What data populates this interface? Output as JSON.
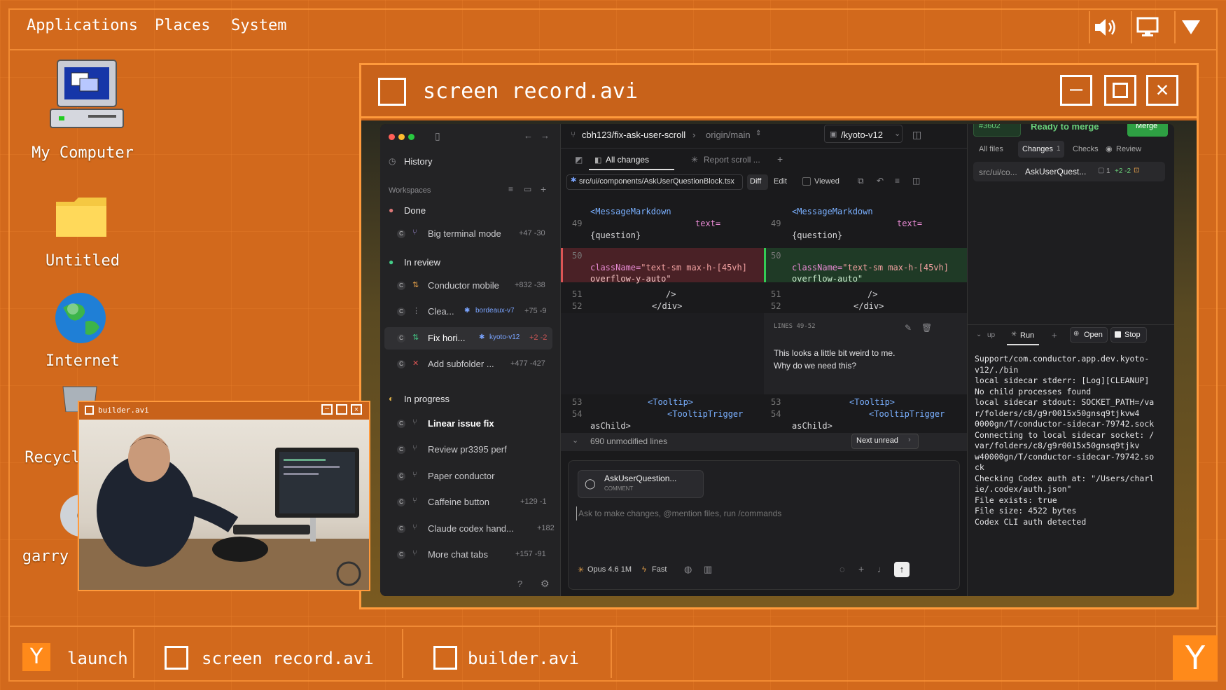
{
  "menubar": {
    "items": [
      "Applications",
      "Places",
      "System"
    ]
  },
  "tray": {
    "volume_icon": "speaker-icon",
    "display_icon": "monitor-icon",
    "menu_icon": "triangle-down-icon"
  },
  "desktop_icons": [
    {
      "label": "My Computer",
      "icon": "computer-icon"
    },
    {
      "label": "Untitled",
      "icon": "folder-icon"
    },
    {
      "label": "Internet",
      "icon": "globe-icon"
    },
    {
      "label": "Recycl",
      "icon": "recycle-bin-icon"
    },
    {
      "label": "garry",
      "icon": "disc-icon"
    }
  ],
  "main_window": {
    "title": "screen record.avi"
  },
  "builder_window": {
    "title": "builder.avi"
  },
  "app": {
    "sidebar": {
      "history": "History",
      "workspaces_label": "Workspaces",
      "groups": [
        {
          "name": "Done",
          "items": [
            {
              "name": "Big terminal mode",
              "stat": "+47 -30"
            }
          ]
        },
        {
          "name": "In review",
          "items": [
            {
              "name": "Conductor mobile",
              "stat": "+832 -38"
            },
            {
              "name": "Clea...",
              "branch": "bordeaux-v7",
              "stat": "+75 -9"
            },
            {
              "name": "Fix hori...",
              "branch": "kyoto-v12",
              "stat": "+2 -2"
            },
            {
              "name": "Add subfolder ...",
              "stat": "+477 -427"
            }
          ]
        },
        {
          "name": "In progress",
          "items": [
            {
              "name": "Linear issue fix",
              "stat": ""
            },
            {
              "name": "Review pr3395 perf",
              "stat": ""
            },
            {
              "name": "Paper conductor",
              "stat": ""
            },
            {
              "name": "Caffeine button",
              "stat": "+129 -1"
            },
            {
              "name": "Claude codex hand...",
              "stat": "+182"
            },
            {
              "name": "More chat tabs",
              "stat": "+157 -91"
            }
          ]
        }
      ],
      "badge": "C"
    },
    "header": {
      "branch": "cbh123/fix-ask-user-scroll",
      "target": "origin/main",
      "workspace": "/kyoto-v12",
      "pr": "#3602",
      "ready": "Ready to merge",
      "merge": "Merge"
    },
    "tabs": {
      "all_changes": "All changes",
      "report": "Report scroll ..."
    },
    "file": {
      "path": "src/ui/components/AskUserQuestionBlock.tsx",
      "diff": "Diff",
      "edit": "Edit",
      "viewed": "Viewed"
    },
    "diff": {
      "l_tag1": "<MessageMarkdown",
      "ln49": "49",
      "attr_text": "text=",
      "question": "{question}",
      "ln50": "50",
      "classname_label": "className=",
      "old_class": "\"text-sm max-h-[45vh]",
      "old_class2": "overflow-y-auto\"",
      "new_class": "\"text-sm max-h-[45vh]",
      "new_class2": "overflow-auto\"",
      "ln51": "51",
      "selfclose": "/>",
      "ln52": "52",
      "closediv": "</div>",
      "comment_header": "LINES 49-52",
      "comment_text1": "This looks a little bit weird to me.",
      "comment_text2": "Why do we need this?",
      "ln53": "53",
      "tooltip": "<Tooltip>",
      "ln54": "54",
      "tooltiptrigger": "<TooltipTrigger",
      "aschild": "asChild>",
      "unmodified": "690 unmodified lines",
      "next_unread": "Next unread"
    },
    "composer": {
      "chip_title": "AskUserQuestion...",
      "chip_sub": "COMMENT",
      "placeholder": "Ask to make changes, @mention files, run /commands",
      "model": "Opus 4.6 1M",
      "fast": "Fast"
    },
    "right": {
      "tabs": [
        "All files",
        "Changes",
        "Checks",
        "Review"
      ],
      "changes_count": "1",
      "file_path": "src/ui/co...",
      "file_name": "AskUserQuest...",
      "file_comments": "1",
      "file_stat": "+2 -2",
      "run_tabs": {
        "up": "up",
        "run": "Run",
        "open": "Open",
        "stop": "Stop"
      },
      "terminal": [
        "Support/com.conductor.app.dev.kyoto-",
        "v12/./bin",
        "local sidecar stderr: [Log][CLEANUP]",
        "No child processes found",
        "local sidecar stdout: SOCKET_PATH=/va",
        "r/folders/c8/g9r0015x50gnsq9tjkvw4",
        "0000gn/T/conductor-sidecar-79742.sock",
        "Connecting to local sidecar socket: /",
        "var/folders/c8/g9r0015x50gnsq9tjkv",
        "w40000gn/T/conductor-sidecar-79742.so",
        "ck",
        "Checking Codex auth at: \"/Users/charl",
        "ie/.codex/auth.json\"",
        "File exists: true",
        "File size: 4522 bytes",
        "Codex CLI auth detected"
      ]
    }
  },
  "taskbar": {
    "launch_glyph": "Y",
    "launch": "launch",
    "items": [
      "screen record.avi",
      "builder.avi"
    ],
    "corner_glyph": "Y"
  },
  "colors": {
    "accent": "#ff9a3c",
    "desktop": "#d2691c",
    "merge_green": "#2ea043"
  }
}
